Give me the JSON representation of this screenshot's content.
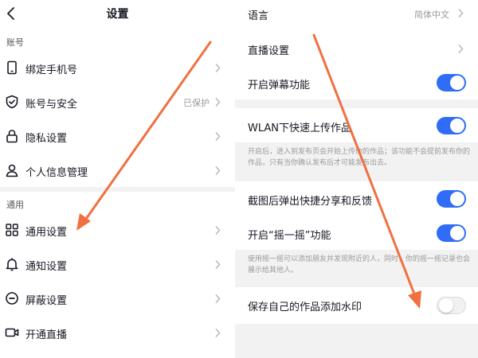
{
  "left": {
    "title": "设置",
    "sections": [
      {
        "title": "账号"
      },
      {
        "title": "通用"
      }
    ],
    "items": [
      {
        "label": "绑定手机号",
        "value": "",
        "icon": "phone-icon"
      },
      {
        "label": "账号与安全",
        "value": "已保护",
        "icon": "shield-icon"
      },
      {
        "label": "隐私设置",
        "value": "",
        "icon": "lock-icon"
      },
      {
        "label": "个人信息管理",
        "value": "",
        "icon": "person-icon"
      },
      {
        "label": "通用设置",
        "value": "",
        "icon": "grid-icon"
      },
      {
        "label": "通知设置",
        "value": "",
        "icon": "bell-icon"
      },
      {
        "label": "屏蔽设置",
        "value": "",
        "icon": "block-icon"
      },
      {
        "label": "开通直播",
        "value": "",
        "icon": "video-icon"
      }
    ]
  },
  "right": {
    "items": [
      {
        "label": "语言",
        "value": "简体中文"
      },
      {
        "label": "直播设置",
        "value": ""
      },
      {
        "label": "开启弹幕功能",
        "toggle": true
      },
      {
        "label": "WLAN下快速上传作品",
        "toggle": true
      },
      {
        "label": "截图后弹出快捷分享和反馈",
        "toggle": true
      },
      {
        "label": "开启“摇一摇”功能",
        "toggle": true
      },
      {
        "label": "保存自己的作品添加水印",
        "toggle": false
      }
    ],
    "descriptions": [
      "开启后，进入到发布页会开始上传你的作品；该功能不会提前发布你的作品，只有当你确认发布后才可能发布出去。",
      "使用摇一摇可以添加朋友并发现附近的人，同时，你的摇一摇记录也会展示给其他人。"
    ]
  },
  "colors": {
    "accent": "#2f6df6",
    "arrow": "#f07040",
    "background_gray": "#f2f2f3"
  }
}
